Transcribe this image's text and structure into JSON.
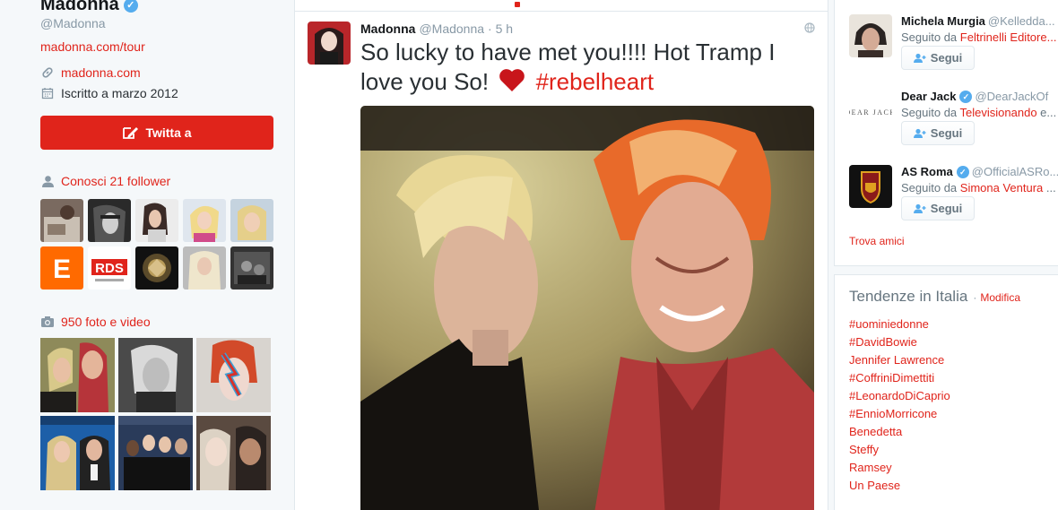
{
  "profile": {
    "name": "Madonna",
    "handle": "@Madonna",
    "url": "madonna.com/tour",
    "website": "madonna.com",
    "joined": "Iscritto a marzo 2012",
    "tweet_to_label": "Twitta a",
    "followers_you_know": "Conosci 21 follower",
    "photos_label": "950 foto e video"
  },
  "tweet": {
    "author": "Madonna",
    "handle": "@Madonna",
    "time": "· 5 h",
    "text_line": "So lucky to have met you!!!! Hot Tramp I love you So!",
    "hashtag": "#rebelheart"
  },
  "who_to_follow": {
    "items": [
      {
        "name": "Michela Murgia",
        "handle": "@Kelledda...",
        "followed_by_prefix": "Seguito da ",
        "followed_by": "Feltrinelli Editore...",
        "verified": false,
        "follow_label": "Segui"
      },
      {
        "name": "Dear Jack",
        "handle": "@DearJackOf",
        "followed_by_prefix": "Seguito da ",
        "followed_by": "Televisionando",
        "followed_by_suffix": " e...",
        "verified": true,
        "follow_label": "Segui",
        "logo_text": "DEAR JACK"
      },
      {
        "name": "AS Roma",
        "handle": "@OfficialASRo...",
        "followed_by_prefix": "Seguito da ",
        "followed_by": "Simona Ventura",
        "followed_by_suffix": " ...",
        "verified": true,
        "follow_label": "Segui"
      }
    ],
    "find_friends": "Trova amici"
  },
  "trends": {
    "title": "Tendenze in Italia",
    "separator": "·",
    "change_label": "Modifica",
    "items": [
      "#uominiedonne",
      "#DavidBowie",
      "Jennifer Lawrence",
      "#CoffriniDimettiti",
      "#LeonardoDiCaprio",
      "#EnnioMorricone",
      "Benedetta",
      "Steffy",
      "Ramsey",
      "Un Paese"
    ]
  },
  "followers_thumbs": {
    "rds_text": "RDS",
    "e_text": "E"
  },
  "colors": {
    "accent": "#e0241b",
    "verified": "#55acee",
    "background": "#f5f8fa"
  }
}
